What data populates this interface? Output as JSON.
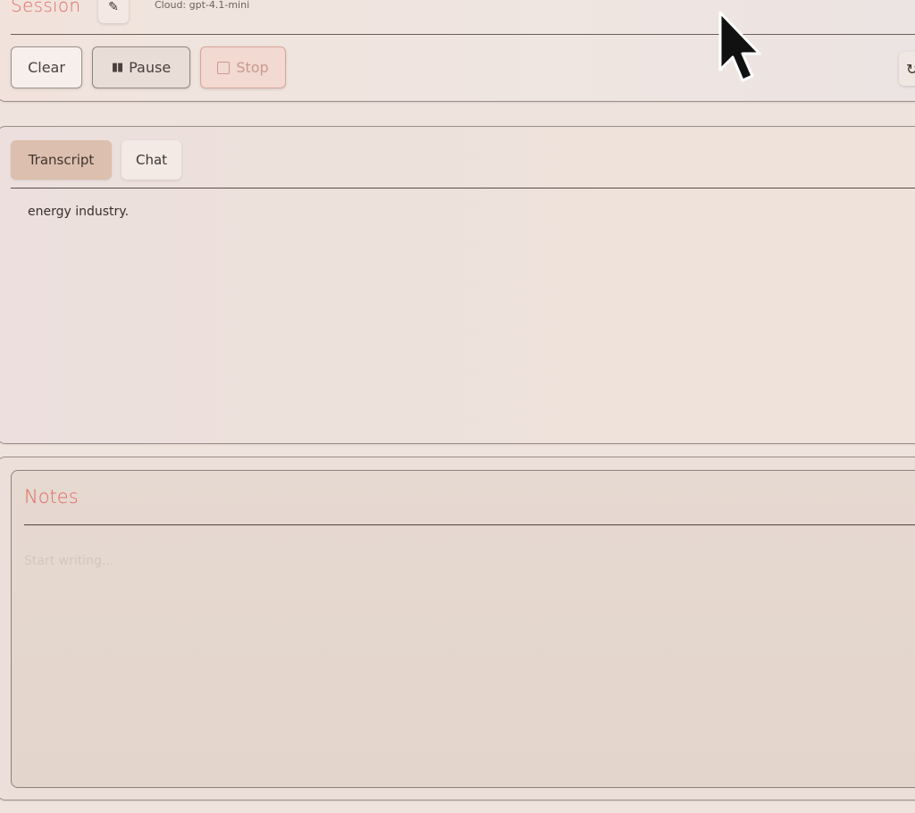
{
  "session": {
    "title": "Session",
    "model_label": "Cloud: gpt-4.1-mini",
    "buttons": {
      "clear": "Clear",
      "pause": "Pause",
      "stop": "Stop"
    }
  },
  "tabs": {
    "transcript": "Transcript",
    "chat": "Chat",
    "active": "Transcript"
  },
  "transcript": {
    "text": "energy industry."
  },
  "notes": {
    "title": "Notes",
    "placeholder": "Start writing..."
  },
  "icons": {
    "edit": "pencil-icon",
    "pause": "pause-icon",
    "stop": "stop-icon",
    "refresh": "refresh-icon",
    "cursor": "mouse-cursor"
  },
  "colors": {
    "accent": "#e06b63",
    "active_tab": "#dcbfae",
    "background": "#efe3dd"
  }
}
